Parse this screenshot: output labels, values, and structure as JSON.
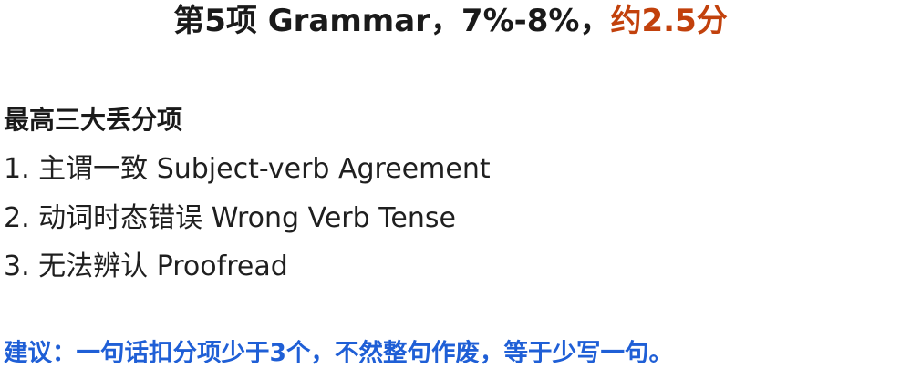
{
  "title": {
    "main": "第5项 Grammar，7%-8%，",
    "accent": "约2.5分"
  },
  "section": {
    "heading": "最高三大丢分项",
    "items": [
      "1. 主谓一致 Subject-verb Agreement",
      "2. 动词时态错误 Wrong Verb Tense",
      "3. 无法辨认 Proofread"
    ]
  },
  "advice": "建议：一句话扣分项少于3个，不然整句作废，等于少写一句。",
  "colors": {
    "accent": "#c2410c",
    "advice": "#1f5fd6",
    "text": "#1a1a1a"
  }
}
